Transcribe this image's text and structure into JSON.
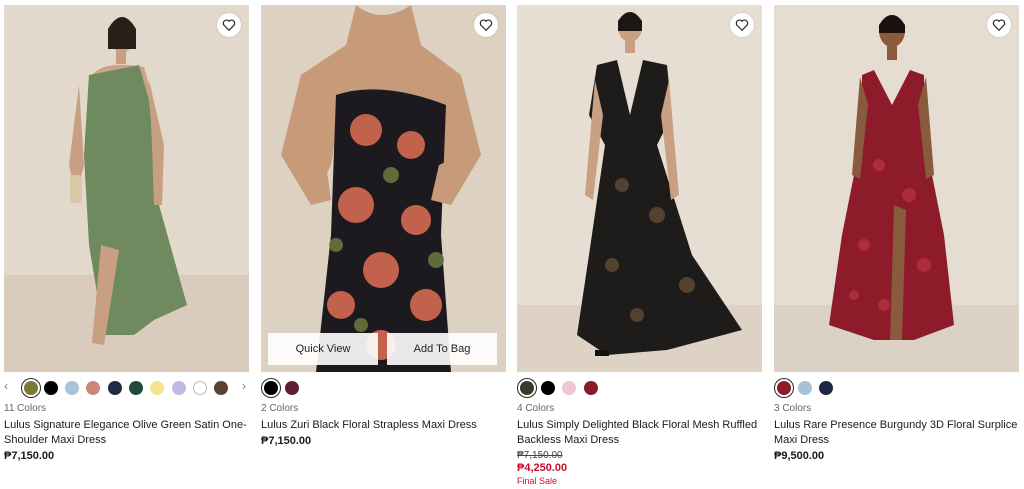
{
  "products": [
    {
      "colors_count": "11 Colors",
      "name": "Lulus Signature Elegance Olive Green Satin One-Shoulder Maxi Dress",
      "price": "₱7,150.00",
      "dress_color": "#6f8a5e",
      "bg_color": "#e2d8cb",
      "swatches": [
        "#7a7a3a",
        "#000000",
        "#a9c6d6",
        "#c98a78",
        "#1f2a44",
        "#1f4a3e",
        "#f3e58f",
        "#c4b7e4",
        "#ffffff",
        "#5a4232"
      ]
    },
    {
      "colors_count": "2 Colors",
      "name": "Lulus Zuri Black Floral Strapless Maxi Dress",
      "price": "₱7,150.00",
      "dress_color": "#1d1a1f",
      "bg_color": "#ddd1c2",
      "quick_view": "Quick View",
      "add_to_bag": "Add To Bag",
      "swatches": [
        "#000000",
        "#5a2030"
      ]
    },
    {
      "colors_count": "4 Colors",
      "name": "Lulus Simply Delighted Black Floral Mesh Ruffled Backless Maxi Dress",
      "original_price": "₱7,150.00",
      "sale_price": "₱4,250.00",
      "final_sale": "Final Sale",
      "dress_color": "#1e1c1b",
      "bg_color": "#e7ded3",
      "swatches": [
        "#3a3a2a",
        "#000000",
        "#efc6d2",
        "#8a1c2a"
      ]
    },
    {
      "colors_count": "3 Colors",
      "name": "Lulus Rare Presence Burgundy 3D Floral Surplice Maxi Dress",
      "price": "₱9,500.00",
      "dress_color": "#8e1b2a",
      "bg_color": "#e5dcd2",
      "swatches": [
        "#8e1b2a",
        "#a7c0d3",
        "#1f2744"
      ]
    }
  ],
  "icons": {
    "favorite": "heart-outline-icon",
    "prev": "chevron-left-icon",
    "next": "chevron-right-icon"
  },
  "glyphs": {
    "prev": "‹",
    "next": "›"
  }
}
